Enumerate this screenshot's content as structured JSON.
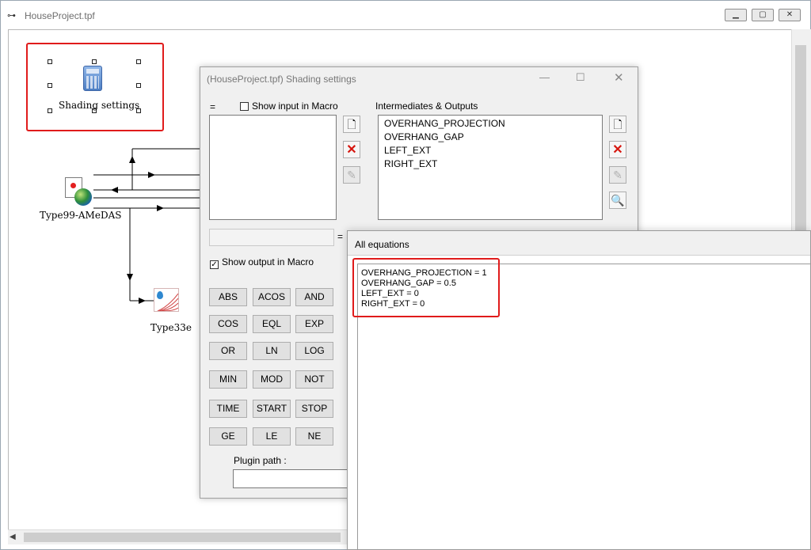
{
  "main_window": {
    "title": "HouseProject.tpf",
    "title_icon_glyph": "⊶"
  },
  "canvas": {
    "components": [
      {
        "id": "shading",
        "label": "Shading settings",
        "icon": "calculator-icon"
      },
      {
        "id": "type99",
        "label": "Type99-AMeDAS",
        "icon": "weather-data-icon"
      },
      {
        "id": "type33",
        "label": "Type33e",
        "icon": "psychrometrics-icon"
      }
    ],
    "selection_color": "#e01b1b"
  },
  "shading_dialog": {
    "title": "(HouseProject.tpf) Shading settings",
    "inputs_header": "=",
    "show_input_label": "Show input in Macro",
    "outputs_header": "Intermediates & Outputs",
    "outputs": [
      "OVERHANG_PROJECTION",
      "OVERHANG_GAP",
      "LEFT_EXT",
      "RIGHT_EXT"
    ],
    "formula_equals": "=",
    "show_output_label": "Show output in Macro",
    "show_output_checked_glyph": "✓",
    "function_buttons": [
      [
        "ABS",
        "ACOS",
        "AND"
      ],
      [
        "COS",
        "EQL",
        "EXP"
      ],
      [
        "OR",
        "LN",
        "LOG"
      ],
      [
        "MIN",
        "MOD",
        "NOT"
      ],
      [
        "TIME",
        "START",
        "STOP"
      ],
      [
        "GE",
        "LE",
        "NE"
      ]
    ],
    "plugin_path_label": "Plugin path :"
  },
  "equations_window": {
    "title": "All equations",
    "lines": [
      "OVERHANG_PROJECTION = 1",
      "OVERHANG_GAP = 0.5",
      "LEFT_EXT = 0",
      "RIGHT_EXT = 0"
    ]
  }
}
